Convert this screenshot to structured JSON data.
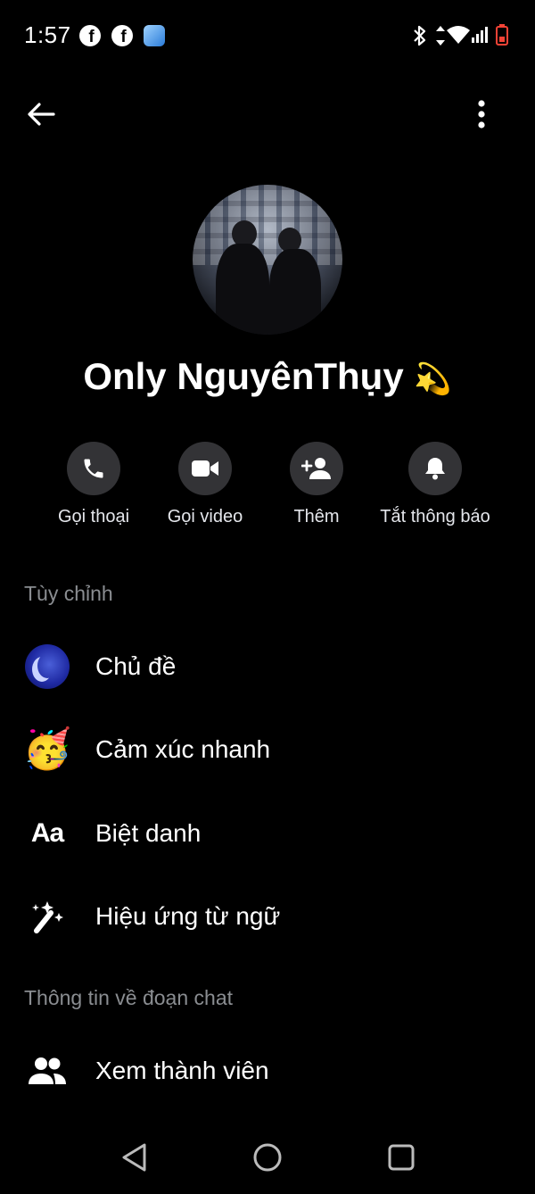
{
  "status_bar": {
    "time": "1:57",
    "left_icons": [
      "facebook-icon",
      "facebook-icon",
      "app-icon"
    ],
    "right_icons": [
      "bluetooth-icon",
      "data-arrows-icon",
      "wifi-icon",
      "signal-icon",
      "battery-low-icon"
    ]
  },
  "header": {
    "contact_name": "Only NguyênThụy",
    "name_emoji": "💫"
  },
  "actions": [
    {
      "label": "Gọi thoại",
      "icon": "phone-icon"
    },
    {
      "label": "Gọi video",
      "icon": "video-camera-icon"
    },
    {
      "label": "Thêm",
      "icon": "add-person-icon"
    },
    {
      "label": "Tắt thông báo",
      "icon": "bell-icon"
    }
  ],
  "sections": {
    "customize_title": "Tùy chỉnh",
    "chat_info_title": "Thông tin về đoạn chat"
  },
  "customize_items": [
    {
      "label": "Chủ đề",
      "icon": "theme-moon-icon"
    },
    {
      "label": "Cảm xúc nhanh",
      "icon": "party-face-emoji-icon",
      "emoji": "🥳"
    },
    {
      "label": "Biệt danh",
      "icon": "nickname-aa-icon",
      "icon_text": "Aa"
    },
    {
      "label": "Hiệu ứng từ ngữ",
      "icon": "magic-wand-icon"
    }
  ],
  "chat_info_items": [
    {
      "label": "Xem thành viên",
      "icon": "people-icon"
    }
  ],
  "colors": {
    "background": "#000000",
    "button_circle": "#333336",
    "section_title": "#8a8d91",
    "theme_blue": "#1f2aa3"
  }
}
